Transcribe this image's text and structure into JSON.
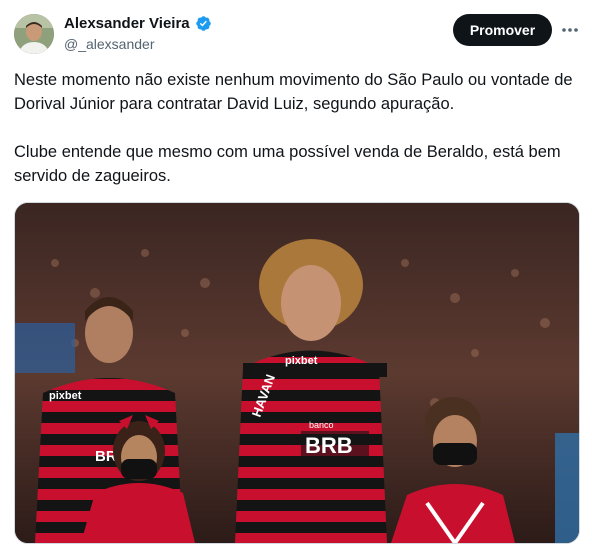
{
  "author": {
    "display_name": "Alexsander Vieira",
    "handle": "@_alexsander",
    "verified_icon": "verified-badge-icon"
  },
  "actions": {
    "promote_label": "Promover",
    "more_icon": "more-horizontal-icon"
  },
  "tweet": {
    "paragraphs": [
      "Neste momento não existe nenhum movimento do São Paulo ou vontade de Dorival Júnior para contratar David Luiz, segundo apuração.",
      "Clube entende que mesmo com uma possível venda de Beraldo, está bem servido de zagueiros."
    ]
  },
  "media": {
    "jersey_texts": {
      "pixbet": "pixbet",
      "sponsor": "BRB",
      "banco": "banco",
      "haven": "HAVAN"
    }
  },
  "colors": {
    "verified": "#1d9bf0",
    "jersey_red": "#c8102e",
    "jersey_black": "#141414"
  }
}
